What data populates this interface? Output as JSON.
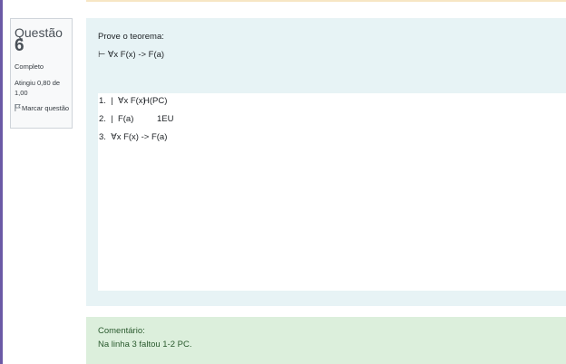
{
  "question_info": {
    "label": "Questão",
    "number": "6",
    "state": "Completo",
    "grade": "Atingiu 0,80 de 1,00",
    "flag_label": "Marcar questão"
  },
  "formulation": {
    "prompt": "Prove o teorema:",
    "theorem": "⊢ ∀x F(x) -> F(a)"
  },
  "proof": {
    "lines": [
      {
        "text": "1.  |  ∀x F(x)",
        "justification": "H(PC)"
      },
      {
        "text": "2.  |  F(a)",
        "justification": "1EU"
      },
      {
        "text": "3.  ∀x F(x) -> F(a)",
        "justification": ""
      }
    ]
  },
  "feedback": {
    "title": "Comentário:",
    "text": "Na linha 3 faltou 1-2 PC."
  },
  "colors": {
    "rail": "#6b5aa6",
    "formulation_bg": "#e7f3f5",
    "feedback_bg": "#dcefdc",
    "feedback_text": "#2a5a2e"
  }
}
